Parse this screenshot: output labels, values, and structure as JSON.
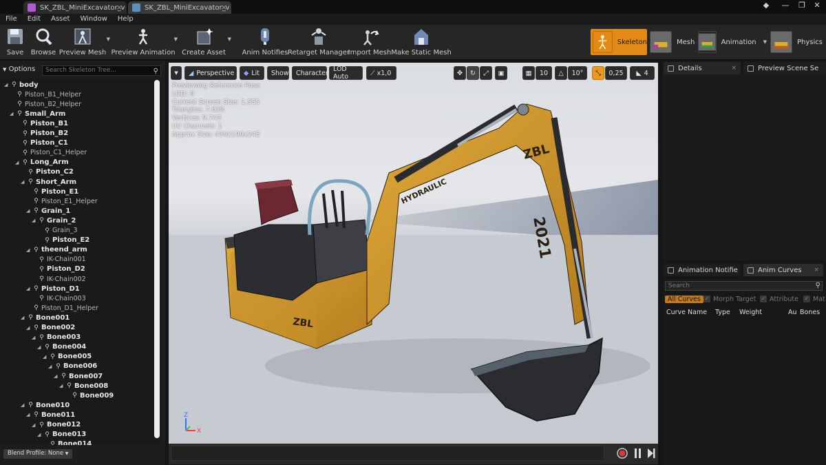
{
  "tabs": [
    {
      "label": "SK_ZBL_MiniExcavator_v",
      "color": "#b05cd0"
    },
    {
      "label": "SK_ZBL_MiniExcavator_v",
      "color": "#5a8fbf"
    }
  ],
  "menu": [
    "File",
    "Edit",
    "Asset",
    "Window",
    "Help"
  ],
  "toolbar": {
    "save": "Save",
    "browse": "Browse",
    "preview_mesh": "Preview Mesh",
    "preview_animation": "Preview Animation",
    "create_asset": "Create Asset",
    "anim_notifies": "Anim Notifies",
    "retarget_manager": "Retarget Manager",
    "import_mesh": "Import Mesh",
    "make_static_mesh": "Make Static Mesh"
  },
  "modes": {
    "skeleton": "Skeleton",
    "mesh": "Mesh",
    "animation": "Animation",
    "physics": "Physics"
  },
  "skeleton_tree": {
    "options_label": "Options",
    "search_placeholder": "Search Skeleton Tree...",
    "blend_profile": "Blend Profile: None",
    "nodes": [
      {
        "label": "body",
        "depth": 0,
        "bold": true
      },
      {
        "label": "Piston_B1_Helper",
        "depth": 1,
        "bold": false
      },
      {
        "label": "Piston_B2_Helper",
        "depth": 1,
        "bold": false
      },
      {
        "label": "Small_Arm",
        "depth": 1,
        "bold": true
      },
      {
        "label": "Piston_B1",
        "depth": 2,
        "bold": true
      },
      {
        "label": "Piston_B2",
        "depth": 2,
        "bold": true
      },
      {
        "label": "Piston_C1",
        "depth": 2,
        "bold": true
      },
      {
        "label": "Piston_C1_Helper",
        "depth": 2,
        "bold": false
      },
      {
        "label": "Long_Arm",
        "depth": 2,
        "bold": true
      },
      {
        "label": "Piston_C2",
        "depth": 3,
        "bold": true
      },
      {
        "label": "Short_Arm",
        "depth": 3,
        "bold": true
      },
      {
        "label": "Piston_E1",
        "depth": 4,
        "bold": true
      },
      {
        "label": "Piston_E1_Helper",
        "depth": 4,
        "bold": false
      },
      {
        "label": "Grain_1",
        "depth": 4,
        "bold": true
      },
      {
        "label": "Grain_2",
        "depth": 5,
        "bold": true
      },
      {
        "label": "Grain_3",
        "depth": 6,
        "bold": false
      },
      {
        "label": "Piston_E2",
        "depth": 6,
        "bold": true
      },
      {
        "label": "theend_arm",
        "depth": 4,
        "bold": true
      },
      {
        "label": "IK-Chain001",
        "depth": 5,
        "bold": false
      },
      {
        "label": "Piston_D2",
        "depth": 5,
        "bold": true
      },
      {
        "label": "IK-Chain002",
        "depth": 5,
        "bold": false
      },
      {
        "label": "Piston_D1",
        "depth": 4,
        "bold": true
      },
      {
        "label": "IK-Chain003",
        "depth": 5,
        "bold": false
      },
      {
        "label": "Piston_D1_Helper",
        "depth": 4,
        "bold": false
      },
      {
        "label": "Bone001",
        "depth": 3,
        "bold": true
      },
      {
        "label": "Bone002",
        "depth": 4,
        "bold": true
      },
      {
        "label": "Bone003",
        "depth": 5,
        "bold": true
      },
      {
        "label": "Bone004",
        "depth": 6,
        "bold": true
      },
      {
        "label": "Bone005",
        "depth": 7,
        "bold": true
      },
      {
        "label": "Bone006",
        "depth": 8,
        "bold": true
      },
      {
        "label": "Bone007",
        "depth": 9,
        "bold": true
      },
      {
        "label": "Bone008",
        "depth": 10,
        "bold": true
      },
      {
        "label": "Bone009",
        "depth": 11,
        "bold": true
      },
      {
        "label": "Bone010",
        "depth": 3,
        "bold": true
      },
      {
        "label": "Bone011",
        "depth": 4,
        "bold": true
      },
      {
        "label": "Bone012",
        "depth": 5,
        "bold": true
      },
      {
        "label": "Bone013",
        "depth": 6,
        "bold": true
      },
      {
        "label": "Bone014",
        "depth": 7,
        "bold": true
      }
    ]
  },
  "viewport": {
    "perspective": "Perspective",
    "lit": "Lit",
    "show": "Show",
    "character": "Character",
    "lod": "LOD Auto",
    "speed": "x1,0",
    "grid_snap": "10",
    "rot_snap": "10°",
    "scale_snap": "0,25",
    "camera_speed": "4",
    "info": [
      "Previewing Reference Pose",
      "LOD: 0",
      "Current Screen Size: 1,555",
      "Triangles: 7.628",
      "Vertices: 9.743",
      "UV Channels: 1",
      "Approx Size: 434x190x245"
    ],
    "axis_z": "Z",
    "axis_x": "X",
    "decal_zbl": "ZBL",
    "decal_year": "2021",
    "decal_hydraulic": "HYDRAULIC"
  },
  "right": {
    "details_tab": "Details",
    "preview_scene_tab": "Preview Scene Se",
    "anim_notifies_tab": "Animation Notifie",
    "anim_curves_tab": "Anim Curves",
    "search_placeholder": "Search",
    "all_curves": "All Curves",
    "morph_target": "Morph Target",
    "attribute": "Attribute",
    "material": "Mat",
    "col_curve_name": "Curve Name",
    "col_type": "Type",
    "col_weight": "Weight",
    "col_au": "Au",
    "col_bones": "Bones"
  }
}
